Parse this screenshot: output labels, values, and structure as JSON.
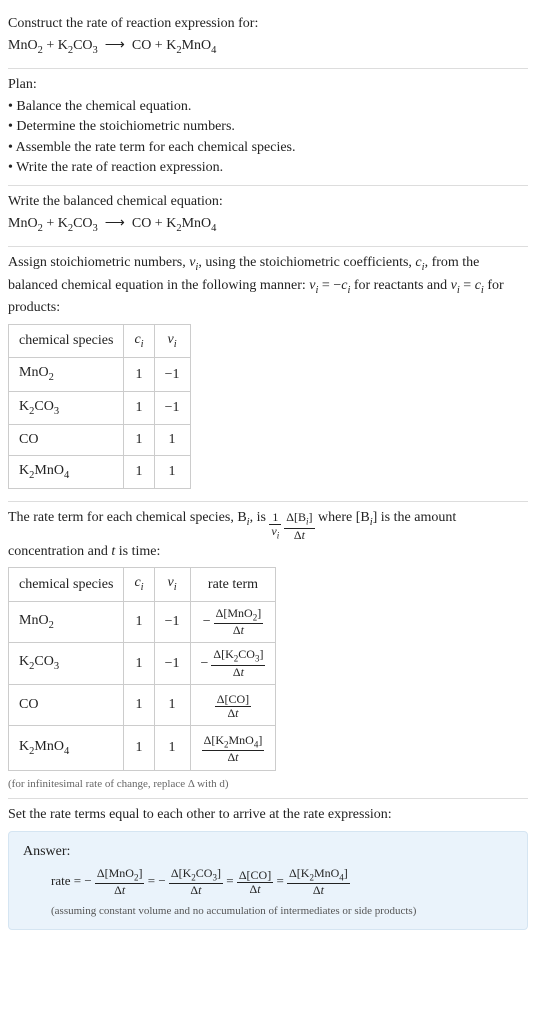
{
  "prompt": {
    "line1": "Construct the rate of reaction expression for:",
    "eqn_html": "MnO<sub>2</sub> + K<sub>2</sub>CO<sub>3</sub> &nbsp;⟶&nbsp; CO + K<sub>2</sub>MnO<sub>4</sub>"
  },
  "plan": {
    "heading": "Plan:",
    "items": [
      "• Balance the chemical equation.",
      "• Determine the stoichiometric numbers.",
      "• Assemble the rate term for each chemical species.",
      "• Write the rate of reaction expression."
    ]
  },
  "balanced": {
    "heading": "Write the balanced chemical equation:",
    "eqn_html": "MnO<sub>2</sub> + K<sub>2</sub>CO<sub>3</sub> &nbsp;⟶&nbsp; CO + K<sub>2</sub>MnO<sub>4</sub>"
  },
  "stoich": {
    "para_html": "Assign stoichiometric numbers, <span class='ital'>ν<sub>i</sub></span>, using the stoichiometric coefficients, <span class='ital'>c<sub>i</sub></span>, from the balanced chemical equation in the following manner: <span class='ital'>ν<sub>i</sub></span> = −<span class='ital'>c<sub>i</sub></span> for reactants and <span class='ital'>ν<sub>i</sub></span> = <span class='ital'>c<sub>i</sub></span> for products:",
    "headers": [
      "chemical species",
      "c_i",
      "ν_i"
    ],
    "rows": [
      {
        "species_html": "MnO<sub>2</sub>",
        "c": "1",
        "nu": "−1"
      },
      {
        "species_html": "K<sub>2</sub>CO<sub>3</sub>",
        "c": "1",
        "nu": "−1"
      },
      {
        "species_html": "CO",
        "c": "1",
        "nu": "1"
      },
      {
        "species_html": "K<sub>2</sub>MnO<sub>4</sub>",
        "c": "1",
        "nu": "1"
      }
    ]
  },
  "rate_terms": {
    "para_pre": "The rate term for each chemical species, B",
    "para_mid": ", is ",
    "frac1_num": "1",
    "frac1_den_html": "<span class='ital'>ν<sub>i</sub></span>",
    "frac2_num_html": "Δ[B<sub><span class='ital'>i</span></sub>]",
    "frac2_den_html": "Δ<span class='ital'>t</span>",
    "para_post_html": " where [B<sub><span class='ital'>i</span></sub>] is the amount concentration and <span class='ital'>t</span> is time:",
    "headers": [
      "chemical species",
      "c_i",
      "ν_i",
      "rate term"
    ],
    "rows": [
      {
        "species_html": "MnO<sub>2</sub>",
        "c": "1",
        "nu": "−1",
        "rate_num_html": "Δ[MnO<sub>2</sub>]",
        "rate_den_html": "Δ<span class='ital'>t</span>",
        "neg": true
      },
      {
        "species_html": "K<sub>2</sub>CO<sub>3</sub>",
        "c": "1",
        "nu": "−1",
        "rate_num_html": "Δ[K<sub>2</sub>CO<sub>3</sub>]",
        "rate_den_html": "Δ<span class='ital'>t</span>",
        "neg": true
      },
      {
        "species_html": "CO",
        "c": "1",
        "nu": "1",
        "rate_num_html": "Δ[CO]",
        "rate_den_html": "Δ<span class='ital'>t</span>",
        "neg": false
      },
      {
        "species_html": "K<sub>2</sub>MnO<sub>4</sub>",
        "c": "1",
        "nu": "1",
        "rate_num_html": "Δ[K<sub>2</sub>MnO<sub>4</sub>]",
        "rate_den_html": "Δ<span class='ital'>t</span>",
        "neg": false
      }
    ],
    "caption": "(for infinitesimal rate of change, replace Δ with d)"
  },
  "final": {
    "heading": "Set the rate terms equal to each other to arrive at the rate expression:"
  },
  "answer": {
    "label": "Answer:",
    "lhs": "rate = ",
    "terms": [
      {
        "neg": true,
        "num_html": "Δ[MnO<sub>2</sub>]",
        "den_html": "Δ<span class='ital'>t</span>"
      },
      {
        "neg": true,
        "num_html": "Δ[K<sub>2</sub>CO<sub>3</sub>]",
        "den_html": "Δ<span class='ital'>t</span>"
      },
      {
        "neg": false,
        "num_html": "Δ[CO]",
        "den_html": "Δ<span class='ital'>t</span>"
      },
      {
        "neg": false,
        "num_html": "Δ[K<sub>2</sub>MnO<sub>4</sub>]",
        "den_html": "Δ<span class='ital'>t</span>"
      }
    ],
    "note": "(assuming constant volume and no accumulation of intermediates or side products)"
  }
}
